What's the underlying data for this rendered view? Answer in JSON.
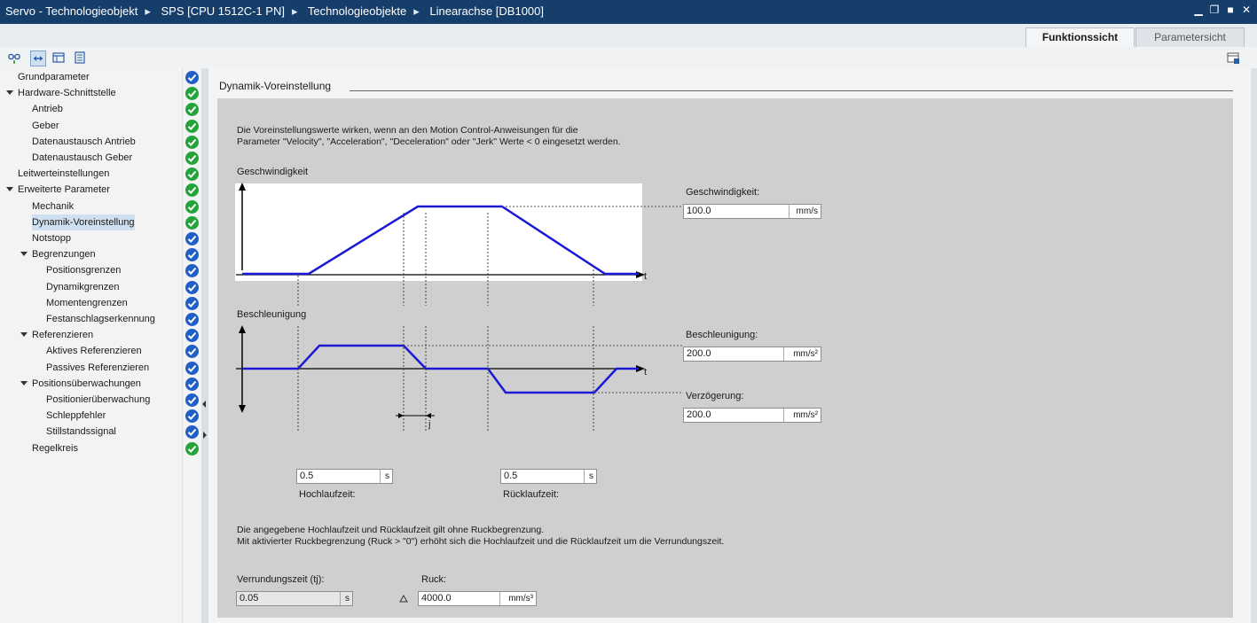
{
  "window": {
    "breadcrumb": [
      "Servo - Technologieobjekt",
      "SPS [CPU 1512C-1 PN]",
      "Technologieobjekte",
      "Linearachse [DB1000]"
    ],
    "separator": "▸",
    "controls": [
      "minimize",
      "restore",
      "maximize",
      "close"
    ]
  },
  "tabs": {
    "function_view": "Funktionssicht",
    "parameter_view": "Parametersicht"
  },
  "nav": {
    "items": [
      {
        "label": "Grundparameter",
        "level": 0,
        "expandable": false,
        "status": "blue"
      },
      {
        "label": "Hardware-Schnittstelle",
        "level": 0,
        "expandable": true,
        "status": "green"
      },
      {
        "label": "Antrieb",
        "level": 1,
        "expandable": false,
        "status": "green"
      },
      {
        "label": "Geber",
        "level": 1,
        "expandable": false,
        "status": "green"
      },
      {
        "label": "Datenaustausch Antrieb",
        "level": 1,
        "expandable": false,
        "status": "green"
      },
      {
        "label": "Datenaustausch Geber",
        "level": 1,
        "expandable": false,
        "status": "green"
      },
      {
        "label": "Leitwerteinstellungen",
        "level": 0,
        "expandable": false,
        "status": "green"
      },
      {
        "label": "Erweiterte Parameter",
        "level": 0,
        "expandable": true,
        "status": "green"
      },
      {
        "label": "Mechanik",
        "level": 1,
        "expandable": false,
        "status": "green"
      },
      {
        "label": "Dynamik-Voreinstellung",
        "level": 1,
        "expandable": false,
        "status": "green",
        "selected": true
      },
      {
        "label": "Notstopp",
        "level": 1,
        "expandable": false,
        "status": "blue"
      },
      {
        "label": "Begrenzungen",
        "level": 1,
        "expandable": true,
        "status": "blue"
      },
      {
        "label": "Positionsgrenzen",
        "level": 2,
        "expandable": false,
        "status": "blue"
      },
      {
        "label": "Dynamikgrenzen",
        "level": 2,
        "expandable": false,
        "status": "blue"
      },
      {
        "label": "Momentengrenzen",
        "level": 2,
        "expandable": false,
        "status": "blue"
      },
      {
        "label": "Festanschlagserkennung",
        "level": 2,
        "expandable": false,
        "status": "blue"
      },
      {
        "label": "Referenzieren",
        "level": 1,
        "expandable": true,
        "status": "blue"
      },
      {
        "label": "Aktives Referenzieren",
        "level": 2,
        "expandable": false,
        "status": "blue"
      },
      {
        "label": "Passives Referenzieren",
        "level": 2,
        "expandable": false,
        "status": "blue"
      },
      {
        "label": "Positionsüberwachungen",
        "level": 1,
        "expandable": true,
        "status": "blue"
      },
      {
        "label": "Positionierüberwachung",
        "level": 2,
        "expandable": false,
        "status": "blue"
      },
      {
        "label": "Schleppfehler",
        "level": 2,
        "expandable": false,
        "status": "blue"
      },
      {
        "label": "Stillstandssignal",
        "level": 2,
        "expandable": false,
        "status": "blue"
      },
      {
        "label": "Regelkreis",
        "level": 1,
        "expandable": false,
        "status": "green"
      }
    ]
  },
  "main": {
    "section_title": "Dynamik-Voreinstellung",
    "intro_line1": "Die Voreinstellungswerte wirken, wenn an den Motion Control-Anweisungen für die",
    "intro_line2": "Parameter \"Velocity\", \"Acceleration\", \"Deceleration\" oder \"Jerk\" Werte < 0 eingesetzt werden.",
    "velocity_plot_title": "Geschwindigkeit",
    "accel_plot_title": "Beschleunigung",
    "t_label": "t",
    "tj_label": "j",
    "velocity": {
      "label": "Geschwindigkeit:",
      "value": "100.0",
      "unit": "mm/s"
    },
    "acceleration": {
      "label": "Beschleunigung:",
      "value": "200.0",
      "unit": "mm/s²"
    },
    "deceleration": {
      "label": "Verzögerung:",
      "value": "200.0",
      "unit": "mm/s²"
    },
    "ramp_up": {
      "label": "Hochlaufzeit:",
      "value": "0.5",
      "unit": "s"
    },
    "ramp_down": {
      "label": "Rücklaufzeit:",
      "value": "0.5",
      "unit": "s"
    },
    "note_line1": "Die angegebene Hochlaufzeit und Rücklaufzeit gilt ohne Ruckbegrenzung.",
    "note_line2": "Mit aktivierter Ruckbegrenzung (Ruck > \"0\") erhöht sich die Hochlaufzeit und die Rücklaufzeit um die Verrundungszeit.",
    "smoothing": {
      "label": "Verrundungszeit (tj):",
      "value": "0.05",
      "unit": "s"
    },
    "jerk": {
      "label": "Ruck:",
      "value": "4000.0",
      "unit": "mm/s³",
      "warning_icon": "warning-triangle-icon"
    }
  },
  "colors": {
    "title_bar": "#163e6b",
    "curve": "#1a1ad6",
    "status_blue": "#1f5fc7",
    "status_green": "#23a33a"
  }
}
